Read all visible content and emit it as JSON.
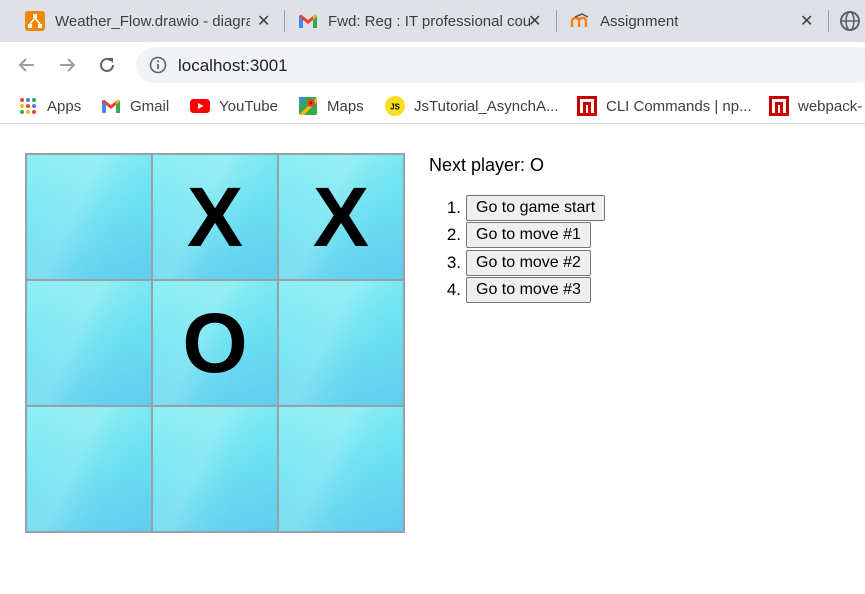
{
  "tabs": [
    {
      "title": "Weather_Flow.drawio - diagra",
      "icon": "drawio-icon"
    },
    {
      "title": "Fwd: Reg : IT professional cou",
      "icon": "gmail-icon"
    },
    {
      "title": "Assignment",
      "icon": "moodle-icon"
    }
  ],
  "address": {
    "url": "localhost:3001"
  },
  "bookmarks": [
    {
      "label": "Apps",
      "icon": "apps-grid-icon"
    },
    {
      "label": "Gmail",
      "icon": "gmail-icon"
    },
    {
      "label": "YouTube",
      "icon": "youtube-icon"
    },
    {
      "label": "Maps",
      "icon": "maps-icon"
    },
    {
      "label": "JsTutorial_AsynchA...",
      "icon": "js-icon"
    },
    {
      "label": "CLI Commands | np...",
      "icon": "npm-icon"
    },
    {
      "label": "webpack-",
      "icon": "npm-icon"
    }
  ],
  "game": {
    "squares": [
      "",
      "X",
      "X",
      "",
      "O",
      "",
      "",
      "",
      ""
    ],
    "status": "Next player: O",
    "moves": [
      {
        "num": "1.",
        "label": "Go to game start"
      },
      {
        "num": "2.",
        "label": "Go to move #1"
      },
      {
        "num": "3.",
        "label": "Go to move #2"
      },
      {
        "num": "4.",
        "label": "Go to move #3"
      }
    ]
  },
  "colors": {
    "tabstrip_bg": "#dee1e6",
    "square_light": "#8cf0f4",
    "square_dark": "#5fcdef"
  }
}
